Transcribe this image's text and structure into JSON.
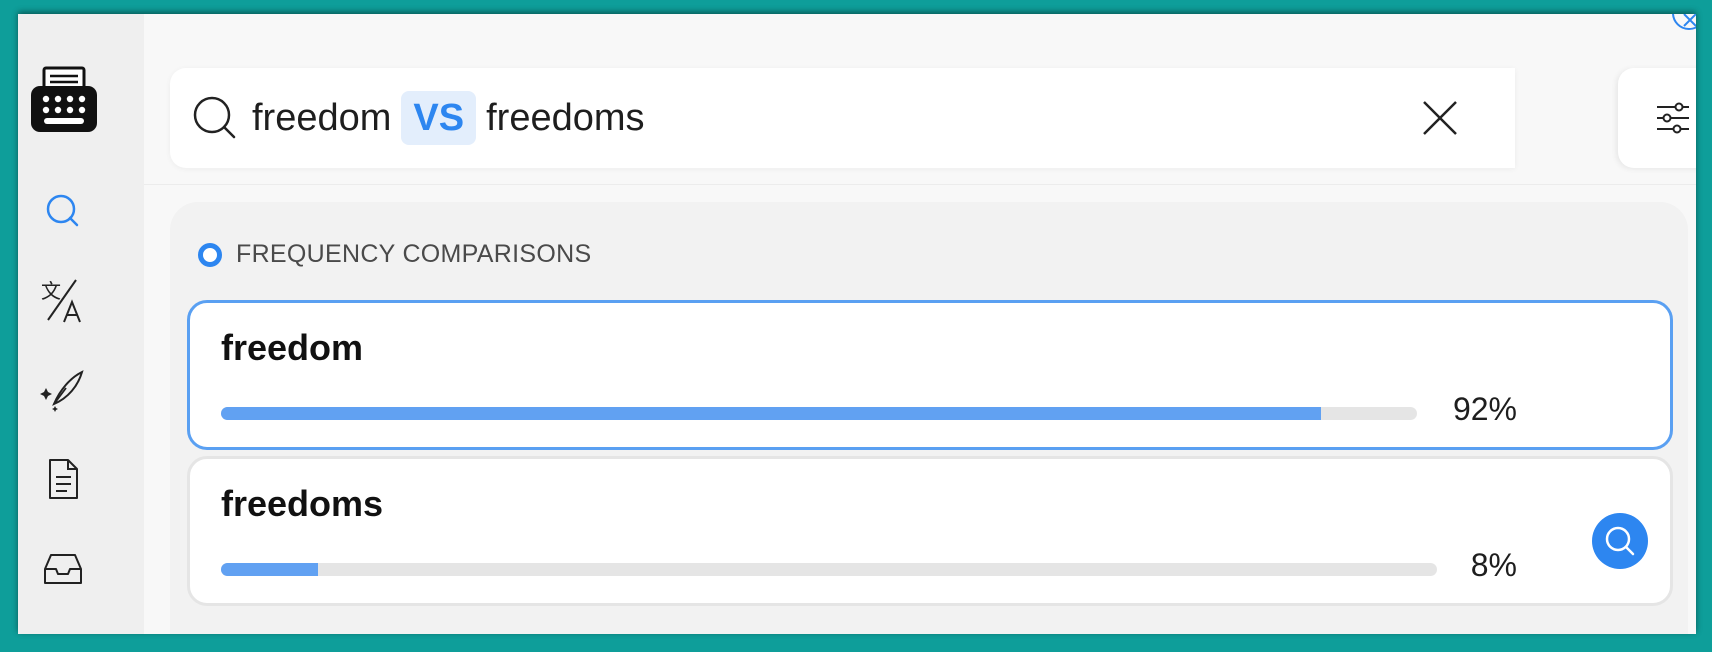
{
  "search": {
    "term_a": "freedom",
    "vs_label": "VS",
    "term_b": "freedoms"
  },
  "sidebar": {
    "items": [
      {
        "icon": "search-icon",
        "active": true
      },
      {
        "icon": "translate-icon",
        "active": false
      },
      {
        "icon": "quill-sparkle-icon",
        "active": false
      },
      {
        "icon": "document-icon",
        "active": false
      },
      {
        "icon": "inbox-icon",
        "active": false
      }
    ]
  },
  "section": {
    "title": "FREQUENCY COMPARISONS"
  },
  "results": [
    {
      "word": "freedom",
      "percent_label": "92%",
      "fraction": 0.92,
      "selected": true
    },
    {
      "word": "freedoms",
      "percent_label": "8%",
      "fraction": 0.08,
      "selected": false
    }
  ],
  "colors": {
    "accent": "#2d86f0",
    "bar_fill": "#61a1f2",
    "frame": "#0e9e9a"
  }
}
